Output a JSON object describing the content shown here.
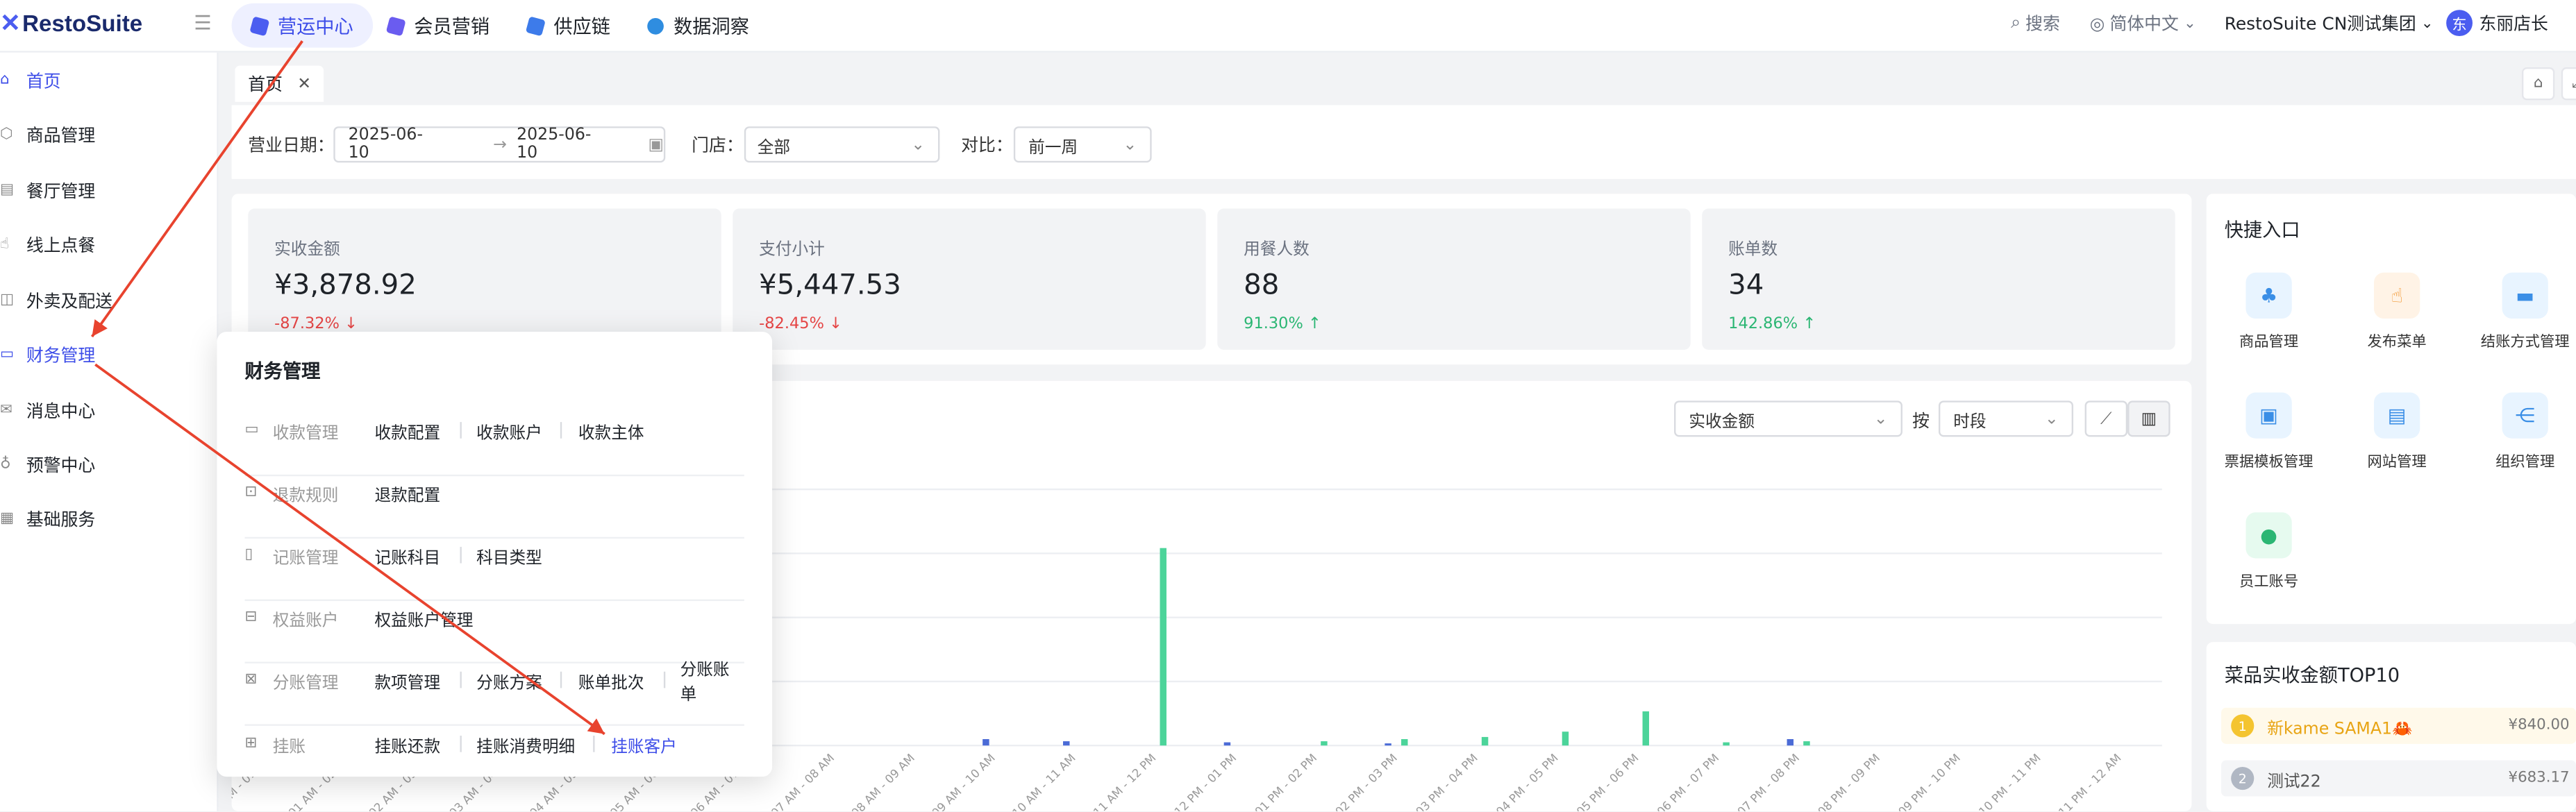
{
  "brand": {
    "name": "RestoSuite"
  },
  "nav": [
    "营运中心",
    "会员营销",
    "供应链",
    "数据洞察"
  ],
  "top_right": {
    "search": "搜索",
    "language": "简体中文",
    "org": "RestoSuite CN测试集团",
    "avatar_initial": "东",
    "user": "东丽店长"
  },
  "sidebar": [
    "首页",
    "商品管理",
    "餐厅管理",
    "线上点餐",
    "外卖及配送",
    "财务管理",
    "消息中心",
    "预警中心",
    "基础服务"
  ],
  "tab": {
    "label": "首页"
  },
  "filters": {
    "date_label": "营业日期：",
    "date_start": "2025-06-10",
    "date_end": "2025-06-10",
    "store_label": "门店：",
    "store_value": "全部",
    "compare_label": "对比：",
    "compare_value": "前一周"
  },
  "kpis": [
    {
      "title": "实收金额",
      "value": "¥3,878.92",
      "delta": "-87.32%",
      "dir": "down"
    },
    {
      "title": "支付小计",
      "value": "¥5,447.53",
      "delta": "-82.45%",
      "dir": "down"
    },
    {
      "title": "用餐人数",
      "value": "88",
      "delta": "91.30%",
      "dir": "up"
    },
    {
      "title": "账单数",
      "value": "34",
      "delta": "142.86%",
      "dir": "up"
    }
  ],
  "chart_controls": {
    "metric": "实收金额",
    "by_label": "按",
    "by_value": "时段"
  },
  "quick": {
    "title": "快捷入口",
    "items": [
      "商品管理",
      "发布菜单",
      "结账方式管理",
      "票据模板管理",
      "网站管理",
      "组织管理",
      "员工账号"
    ]
  },
  "top10": {
    "title": "菜品实收金额TOP10",
    "items": [
      {
        "name": "新kame SAMA1🦀",
        "amount": "¥840.00"
      },
      {
        "name": "测试22",
        "amount": "¥683.17"
      }
    ]
  },
  "popup": {
    "title": "财务管理",
    "rows": [
      {
        "category": "收款管理",
        "links": [
          "收款配置",
          "收款账户",
          "收款主体"
        ]
      },
      {
        "category": "退款规则",
        "links": [
          "退款配置"
        ]
      },
      {
        "category": "记账管理",
        "links": [
          "记账科目",
          "科目类型"
        ]
      },
      {
        "category": "权益账户",
        "links": [
          "权益账户管理"
        ]
      },
      {
        "category": "分账管理",
        "links": [
          "款项管理",
          "分账方案",
          "账单批次",
          "分账账单"
        ]
      },
      {
        "category": "挂账",
        "links": [
          "挂账还款",
          "挂账消费明细",
          "挂账客户"
        ]
      }
    ]
  },
  "chart_data": {
    "type": "bar",
    "categories": [
      "12 AM - 01 AM",
      "01 AM - 02 AM",
      "02 AM - 03 AM",
      "03 AM - 04 AM",
      "04 AM - 05 AM",
      "05 AM - 06 AM",
      "06 AM - 07 AM",
      "07 AM - 08 AM",
      "08 AM - 09 AM",
      "09 AM - 10 AM",
      "10 AM - 11 AM",
      "11 AM - 12 PM",
      "12 PM - 01 PM",
      "01 PM - 02 PM",
      "02 PM - 03 PM",
      "03 PM - 04 PM",
      "04 PM - 05 PM",
      "05 PM - 06 PM",
      "06 PM - 07 PM",
      "07 PM - 08 PM",
      "08 PM - 09 PM",
      "09 PM - 10 PM",
      "10 PM - 11 PM",
      "11 PM - 12 AM"
    ],
    "series": [
      {
        "color": "#4b6bd6",
        "values": [
          0,
          0,
          0,
          0,
          0,
          0,
          0,
          0,
          0,
          60,
          40,
          0,
          30,
          0,
          20,
          0,
          0,
          0,
          0,
          60,
          0,
          0,
          0,
          0
        ]
      },
      {
        "color": "#4cd49a",
        "values": [
          0,
          0,
          0,
          0,
          0,
          0,
          0,
          0,
          0,
          0,
          0,
          1850,
          0,
          40,
          60,
          80,
          130,
          320,
          30,
          40,
          0,
          0,
          0,
          0
        ]
      }
    ],
    "ylim": [
      0,
      2400
    ],
    "grid": true
  },
  "colors": {
    "accent": "#3d4de8",
    "down": "#e54545",
    "up": "#2bb673",
    "annotation": "#e8432e"
  }
}
